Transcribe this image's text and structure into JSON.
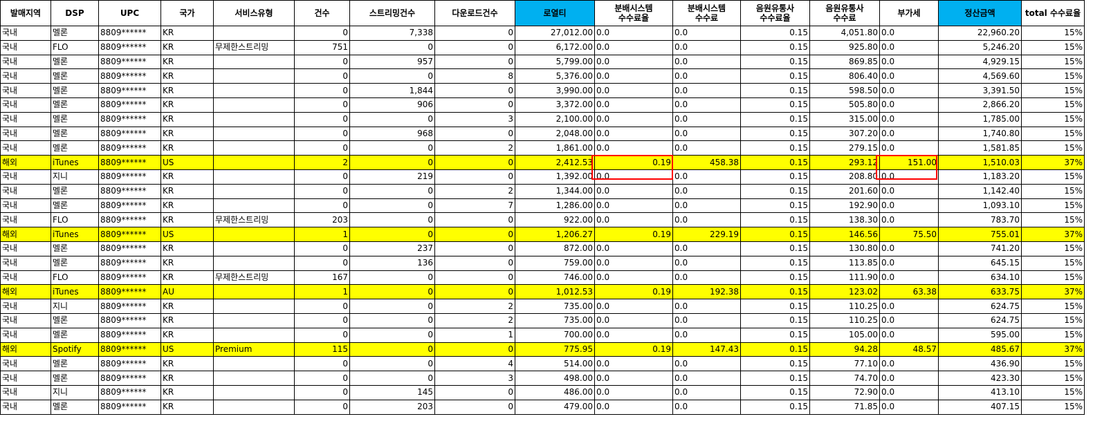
{
  "headers": [
    {
      "text": "발매지역",
      "highlight": false
    },
    {
      "text": "DSP",
      "highlight": false
    },
    {
      "text": "UPC",
      "highlight": false
    },
    {
      "text": "국가",
      "highlight": false
    },
    {
      "text": "서비스유형",
      "highlight": false
    },
    {
      "text": "건수",
      "highlight": false
    },
    {
      "text": "스트리밍건수",
      "highlight": false
    },
    {
      "text": "다운로드건수",
      "highlight": false
    },
    {
      "text": "로열티",
      "highlight": true
    },
    {
      "text": "분배시스템\n수수료율",
      "highlight": false
    },
    {
      "text": "분배시스템\n수수료",
      "highlight": false
    },
    {
      "text": "음원유통사\n수수료율",
      "highlight": false
    },
    {
      "text": "음원유통사\n수수료",
      "highlight": false
    },
    {
      "text": "부가세",
      "highlight": false
    },
    {
      "text": "정산금액",
      "highlight": true
    },
    {
      "text": "total 수수료율",
      "highlight": false
    }
  ],
  "rows": [
    {
      "hl": false,
      "c": [
        "국내",
        "멜론",
        "8809******",
        "KR",
        "",
        "0",
        "7,338",
        "0",
        "27,012.00",
        "0.0",
        "0.0",
        "0.15",
        "4,051.80",
        "0.0",
        "22,960.20",
        "15%"
      ]
    },
    {
      "hl": false,
      "c": [
        "국내",
        "FLO",
        "8809******",
        "KR",
        "무제한스트리밍",
        "751",
        "0",
        "0",
        "6,172.00",
        "0.0",
        "0.0",
        "0.15",
        "925.80",
        "0.0",
        "5,246.20",
        "15%"
      ]
    },
    {
      "hl": false,
      "c": [
        "국내",
        "멜론",
        "8809******",
        "KR",
        "",
        "0",
        "957",
        "0",
        "5,799.00",
        "0.0",
        "0.0",
        "0.15",
        "869.85",
        "0.0",
        "4,929.15",
        "15%"
      ]
    },
    {
      "hl": false,
      "c": [
        "국내",
        "멜론",
        "8809******",
        "KR",
        "",
        "0",
        "0",
        "8",
        "5,376.00",
        "0.0",
        "0.0",
        "0.15",
        "806.40",
        "0.0",
        "4,569.60",
        "15%"
      ]
    },
    {
      "hl": false,
      "c": [
        "국내",
        "멜론",
        "8809******",
        "KR",
        "",
        "0",
        "1,844",
        "0",
        "3,990.00",
        "0.0",
        "0.0",
        "0.15",
        "598.50",
        "0.0",
        "3,391.50",
        "15%"
      ]
    },
    {
      "hl": false,
      "c": [
        "국내",
        "멜론",
        "8809******",
        "KR",
        "",
        "0",
        "906",
        "0",
        "3,372.00",
        "0.0",
        "0.0",
        "0.15",
        "505.80",
        "0.0",
        "2,866.20",
        "15%"
      ]
    },
    {
      "hl": false,
      "c": [
        "국내",
        "멜론",
        "8809******",
        "KR",
        "",
        "0",
        "0",
        "3",
        "2,100.00",
        "0.0",
        "0.0",
        "0.15",
        "315.00",
        "0.0",
        "1,785.00",
        "15%"
      ]
    },
    {
      "hl": false,
      "c": [
        "국내",
        "멜론",
        "8809******",
        "KR",
        "",
        "0",
        "968",
        "0",
        "2,048.00",
        "0.0",
        "0.0",
        "0.15",
        "307.20",
        "0.0",
        "1,740.80",
        "15%"
      ]
    },
    {
      "hl": false,
      "c": [
        "국내",
        "멜론",
        "8809******",
        "KR",
        "",
        "0",
        "0",
        "2",
        "1,861.00",
        "0.0",
        "0.0",
        "0.15",
        "279.15",
        "0.0",
        "1,581.85",
        "15%"
      ]
    },
    {
      "hl": true,
      "c": [
        "해외",
        "iTunes",
        "8809******",
        "US",
        "",
        "2",
        "0",
        "0",
        "2,412.53",
        "0.19",
        "458.38",
        "0.15",
        "293.12",
        "151.00",
        "1,510.03",
        "37%"
      ]
    },
    {
      "hl": false,
      "c": [
        "국내",
        "지니",
        "8809******",
        "KR",
        "",
        "0",
        "219",
        "0",
        "1,392.00",
        "0.0",
        "0.0",
        "0.15",
        "208.80",
        "0.0",
        "1,183.20",
        "15%"
      ]
    },
    {
      "hl": false,
      "c": [
        "국내",
        "멜론",
        "8809******",
        "KR",
        "",
        "0",
        "0",
        "2",
        "1,344.00",
        "0.0",
        "0.0",
        "0.15",
        "201.60",
        "0.0",
        "1,142.40",
        "15%"
      ]
    },
    {
      "hl": false,
      "c": [
        "국내",
        "멜론",
        "8809******",
        "KR",
        "",
        "0",
        "0",
        "7",
        "1,286.00",
        "0.0",
        "0.0",
        "0.15",
        "192.90",
        "0.0",
        "1,093.10",
        "15%"
      ]
    },
    {
      "hl": false,
      "c": [
        "국내",
        "FLO",
        "8809******",
        "KR",
        "무제한스트리밍",
        "203",
        "0",
        "0",
        "922.00",
        "0.0",
        "0.0",
        "0.15",
        "138.30",
        "0.0",
        "783.70",
        "15%"
      ]
    },
    {
      "hl": true,
      "c": [
        "해외",
        "iTunes",
        "8809******",
        "US",
        "",
        "1",
        "0",
        "0",
        "1,206.27",
        "0.19",
        "229.19",
        "0.15",
        "146.56",
        "75.50",
        "755.01",
        "37%"
      ]
    },
    {
      "hl": false,
      "c": [
        "국내",
        "멜론",
        "8809******",
        "KR",
        "",
        "0",
        "237",
        "0",
        "872.00",
        "0.0",
        "0.0",
        "0.15",
        "130.80",
        "0.0",
        "741.20",
        "15%"
      ]
    },
    {
      "hl": false,
      "c": [
        "국내",
        "멜론",
        "8809******",
        "KR",
        "",
        "0",
        "136",
        "0",
        "759.00",
        "0.0",
        "0.0",
        "0.15",
        "113.85",
        "0.0",
        "645.15",
        "15%"
      ]
    },
    {
      "hl": false,
      "c": [
        "국내",
        "FLO",
        "8809******",
        "KR",
        "무제한스트리밍",
        "167",
        "0",
        "0",
        "746.00",
        "0.0",
        "0.0",
        "0.15",
        "111.90",
        "0.0",
        "634.10",
        "15%"
      ]
    },
    {
      "hl": true,
      "c": [
        "해외",
        "iTunes",
        "8809******",
        "AU",
        "",
        "1",
        "0",
        "0",
        "1,012.53",
        "0.19",
        "192.38",
        "0.15",
        "123.02",
        "63.38",
        "633.75",
        "37%"
      ]
    },
    {
      "hl": false,
      "c": [
        "국내",
        "지니",
        "8809******",
        "KR",
        "",
        "0",
        "0",
        "2",
        "735.00",
        "0.0",
        "0.0",
        "0.15",
        "110.25",
        "0.0",
        "624.75",
        "15%"
      ]
    },
    {
      "hl": false,
      "c": [
        "국내",
        "멜론",
        "8809******",
        "KR",
        "",
        "0",
        "0",
        "2",
        "735.00",
        "0.0",
        "0.0",
        "0.15",
        "110.25",
        "0.0",
        "624.75",
        "15%"
      ]
    },
    {
      "hl": false,
      "c": [
        "국내",
        "멜론",
        "8809******",
        "KR",
        "",
        "0",
        "0",
        "1",
        "700.00",
        "0.0",
        "0.0",
        "0.15",
        "105.00",
        "0.0",
        "595.00",
        "15%"
      ]
    },
    {
      "hl": true,
      "c": [
        "해외",
        "Spotify",
        "8809******",
        "US",
        "Premium",
        "115",
        "0",
        "0",
        "775.95",
        "0.19",
        "147.43",
        "0.15",
        "94.28",
        "48.57",
        "485.67",
        "37%"
      ]
    },
    {
      "hl": false,
      "c": [
        "국내",
        "멜론",
        "8809******",
        "KR",
        "",
        "0",
        "0",
        "4",
        "514.00",
        "0.0",
        "0.0",
        "0.15",
        "77.10",
        "0.0",
        "436.90",
        "15%"
      ]
    },
    {
      "hl": false,
      "c": [
        "국내",
        "멜론",
        "8809******",
        "KR",
        "",
        "0",
        "0",
        "3",
        "498.00",
        "0.0",
        "0.0",
        "0.15",
        "74.70",
        "0.0",
        "423.30",
        "15%"
      ]
    },
    {
      "hl": false,
      "c": [
        "국내",
        "지니",
        "8809******",
        "KR",
        "",
        "0",
        "145",
        "0",
        "486.00",
        "0.0",
        "0.0",
        "0.15",
        "72.90",
        "0.0",
        "413.10",
        "15%"
      ]
    },
    {
      "hl": false,
      "c": [
        "국내",
        "멜론",
        "8809******",
        "KR",
        "",
        "0",
        "203",
        "0",
        "479.00",
        "0.0",
        "0.0",
        "0.15",
        "71.85",
        "0.0",
        "407.15",
        "15%"
      ]
    }
  ]
}
